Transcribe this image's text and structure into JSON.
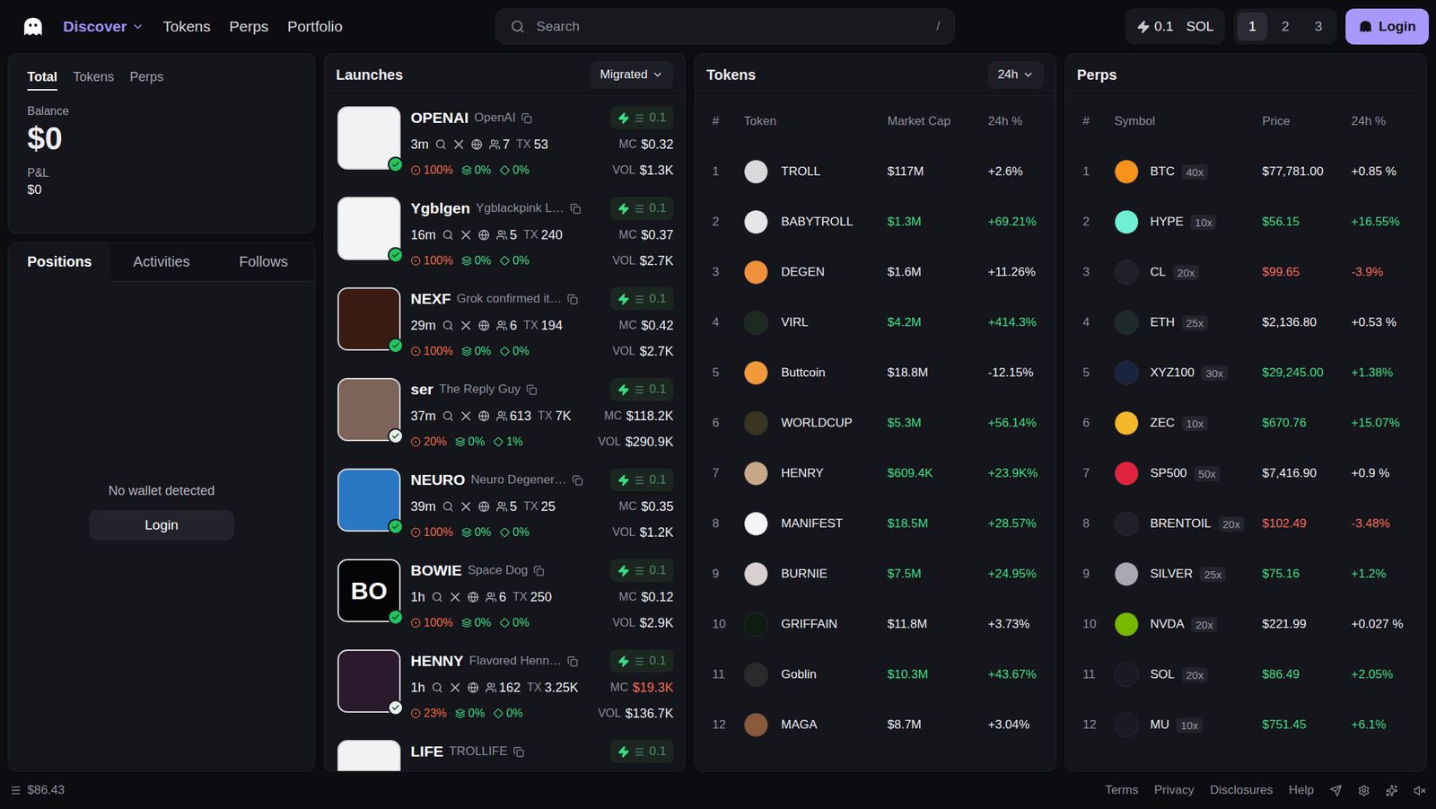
{
  "nav": {
    "items": [
      {
        "label": "Discover",
        "selected": true,
        "has_menu": true
      },
      {
        "label": "Tokens",
        "selected": false,
        "has_menu": false
      },
      {
        "label": "Perps",
        "selected": false,
        "has_menu": false
      },
      {
        "label": "Portfolio",
        "selected": false,
        "has_menu": false
      }
    ]
  },
  "search": {
    "placeholder": "Search",
    "shortcut": "/"
  },
  "quick_buy": {
    "amount": "0.1",
    "currency": "SOL"
  },
  "presets": [
    {
      "label": "1",
      "selected": true
    },
    {
      "label": "2",
      "selected": false
    },
    {
      "label": "3",
      "selected": false
    }
  ],
  "login_button": "Login",
  "account": {
    "tabs": [
      {
        "label": "Total",
        "selected": true
      },
      {
        "label": "Tokens",
        "selected": false
      },
      {
        "label": "Perps",
        "selected": false
      }
    ],
    "balance_label": "Balance",
    "balance": "$0",
    "pnl_label": "P&L",
    "pnl": "$0"
  },
  "positions": {
    "tabs": [
      {
        "label": "Positions",
        "selected": true
      },
      {
        "label": "Activities",
        "selected": false
      },
      {
        "label": "Follows",
        "selected": false
      }
    ],
    "empty_text": "No wallet detected",
    "login_button": "Login"
  },
  "launches": {
    "title": "Launches",
    "filter": "Migrated",
    "labels": {
      "tx": "TX",
      "mc": "MC",
      "vol": "VOL"
    },
    "rows": [
      {
        "name": "OPENAI",
        "desc": "OpenAI",
        "avatar": {
          "color": "#f2f2f4",
          "text": ""
        },
        "badge_color": "#22c55e",
        "buy": "0.1",
        "age": "3m",
        "holders": "7",
        "tx": "53",
        "mc": "$0.32",
        "mc_color": "#ececf1",
        "vol": "$1.3K",
        "stats": [
          "100%",
          "0%",
          "0%"
        ]
      },
      {
        "name": "Ygblgen",
        "desc": "Ygblackpink L…",
        "avatar": {
          "color": "#f4f4f4",
          "text": ""
        },
        "badge_color": "#22c55e",
        "buy": "0.1",
        "age": "16m",
        "holders": "5",
        "tx": "240",
        "mc": "$0.37",
        "mc_color": "#ececf1",
        "vol": "$2.7K",
        "stats": [
          "100%",
          "0%",
          "0%"
        ]
      },
      {
        "name": "NEXF",
        "desc": "Grok confirmed it…",
        "avatar": {
          "color": "#3a1c12",
          "text": ""
        },
        "badge_color": "#22c55e",
        "buy": "0.1",
        "age": "29m",
        "holders": "6",
        "tx": "194",
        "mc": "$0.42",
        "mc_color": "#ececf1",
        "vol": "$2.7K",
        "stats": [
          "100%",
          "0%",
          "0%"
        ]
      },
      {
        "name": "ser",
        "desc": "The Reply Guy",
        "avatar": {
          "color": "#7d6458",
          "text": ""
        },
        "badge_color": "#e8efe9",
        "buy": "0.1",
        "age": "37m",
        "holders": "613",
        "tx": "7K",
        "mc": "$118.2K",
        "mc_color": "#ececf1",
        "vol": "$290.9K",
        "stats": [
          "20%",
          "0%",
          "1%"
        ]
      },
      {
        "name": "NEURO",
        "desc": "Neuro Degener…",
        "avatar": {
          "color": "#2a78c4",
          "text": ""
        },
        "badge_color": "#22c55e",
        "buy": "0.1",
        "age": "39m",
        "holders": "5",
        "tx": "25",
        "mc": "$0.35",
        "mc_color": "#ececf1",
        "vol": "$1.2K",
        "stats": [
          "100%",
          "0%",
          "0%"
        ]
      },
      {
        "name": "BOWIE",
        "desc": "Space Dog",
        "avatar": {
          "color": "#050505",
          "text": "BO"
        },
        "badge_color": "#22c55e",
        "buy": "0.1",
        "age": "1h",
        "holders": "6",
        "tx": "250",
        "mc": "$0.12",
        "mc_color": "#ececf1",
        "vol": "$2.9K",
        "stats": [
          "100%",
          "0%",
          "0%"
        ]
      },
      {
        "name": "HENNY",
        "desc": "Flavored Henn…",
        "avatar": {
          "color": "#2b1a2e",
          "text": ""
        },
        "badge_color": "#e8efe9",
        "buy": "0.1",
        "age": "1h",
        "holders": "162",
        "tx": "3.25K",
        "mc": "$19.3K",
        "mc_color": "#f26b5b",
        "vol": "$136.7K",
        "stats": [
          "23%",
          "0%",
          "0%"
        ]
      },
      {
        "name": "LIFE",
        "desc": "TROLLIFE",
        "avatar": {
          "color": "#f2f2f2",
          "text": ""
        },
        "badge_color": "#22c55e",
        "buy": "0.1"
      }
    ]
  },
  "tokens": {
    "title": "Tokens",
    "period": "24h",
    "columns": [
      "#",
      "Token",
      "Market Cap",
      "24h %"
    ],
    "rows": [
      {
        "rank": "1",
        "name": "TROLL",
        "market_cap": "$117M",
        "change": "+2.6%",
        "updated": false,
        "color": "#d9d9d9"
      },
      {
        "rank": "2",
        "name": "BABYTROLL",
        "market_cap": "$1.3M",
        "change": "+69.21%",
        "updated": true,
        "color": "#e6e6e6"
      },
      {
        "rank": "3",
        "name": "DEGEN",
        "market_cap": "$1.6M",
        "change": "+11.26%",
        "updated": false,
        "color": "#f0913a"
      },
      {
        "rank": "4",
        "name": "VIRL",
        "market_cap": "$4.2M",
        "change": "+414.3%",
        "updated": true,
        "color": "#1d2a21"
      },
      {
        "rank": "5",
        "name": "Buttcoin",
        "market_cap": "$18.8M",
        "change": "-12.15%",
        "updated": false,
        "color": "#f29a3b"
      },
      {
        "rank": "6",
        "name": "WORLDCUP",
        "market_cap": "$5.3M",
        "change": "+56.14%",
        "updated": true,
        "color": "#3a3520"
      },
      {
        "rank": "7",
        "name": "HENRY",
        "market_cap": "$609.4K",
        "change": "+23.9K%",
        "updated": true,
        "color": "#c9a88a"
      },
      {
        "rank": "8",
        "name": "MANIFEST",
        "market_cap": "$18.5M",
        "change": "+28.57%",
        "updated": true,
        "color": "#f5f5f5"
      },
      {
        "rank": "9",
        "name": "BURNIE",
        "market_cap": "$7.5M",
        "change": "+24.95%",
        "updated": true,
        "color": "#d8d0d0"
      },
      {
        "rank": "10",
        "name": "GRIFFAIN",
        "market_cap": "$11.8M",
        "change": "+3.73%",
        "updated": false,
        "color": "#0f1c12"
      },
      {
        "rank": "11",
        "name": "Goblin",
        "market_cap": "$10.3M",
        "change": "+43.67%",
        "updated": true,
        "color": "#2a2a2a"
      },
      {
        "rank": "12",
        "name": "MAGA",
        "market_cap": "$8.7M",
        "change": "+3.04%",
        "updated": false,
        "color": "#8a5a3a"
      }
    ]
  },
  "perps": {
    "title": "Perps",
    "columns": [
      "#",
      "Symbol",
      "Price",
      "24h %"
    ],
    "rows": [
      {
        "rank": "1",
        "symbol": "BTC",
        "leverage": "40x",
        "price": "$77,781.00",
        "change": "+0.85 %",
        "trend": "flat",
        "color": "#f7931a"
      },
      {
        "rank": "2",
        "symbol": "HYPE",
        "leverage": "10x",
        "price": "$56.15",
        "change": "+16.55%",
        "trend": "up",
        "color": "#6ff0d3"
      },
      {
        "rank": "3",
        "symbol": "CL",
        "leverage": "20x",
        "price": "$99.65",
        "change": "-3.9%",
        "trend": "down",
        "color": "#202028"
      },
      {
        "rank": "4",
        "symbol": "ETH",
        "leverage": "25x",
        "price": "$2,136.80",
        "change": "+0.53 %",
        "trend": "flat",
        "color": "#1f2a2a"
      },
      {
        "rank": "5",
        "symbol": "XYZ100",
        "leverage": "30x",
        "price": "$29,245.00",
        "change": "+1.38%",
        "trend": "up",
        "color": "#1a2340"
      },
      {
        "rank": "6",
        "symbol": "ZEC",
        "leverage": "10x",
        "price": "$670.76",
        "change": "+15.07%",
        "trend": "up",
        "color": "#f4b728"
      },
      {
        "rank": "7",
        "symbol": "SP500",
        "leverage": "50x",
        "price": "$7,416.90",
        "change": "+0.9 %",
        "trend": "flat",
        "color": "#e0233d"
      },
      {
        "rank": "8",
        "symbol": "BRENTOIL",
        "leverage": "20x",
        "price": "$102.49",
        "change": "-3.48%",
        "trend": "down",
        "color": "#202028"
      },
      {
        "rank": "9",
        "symbol": "SILVER",
        "leverage": "25x",
        "price": "$75.16",
        "change": "+1.2%",
        "trend": "up",
        "color": "#a9a9b3"
      },
      {
        "rank": "10",
        "symbol": "NVDA",
        "leverage": "20x",
        "price": "$221.99",
        "change": "+0.027 %",
        "trend": "flat",
        "color": "#76b900"
      },
      {
        "rank": "11",
        "symbol": "SOL",
        "leverage": "20x",
        "price": "$86.49",
        "change": "+2.05%",
        "trend": "up",
        "color": "#1a1a24"
      },
      {
        "rank": "12",
        "symbol": "MU",
        "leverage": "10x",
        "price": "$751.45",
        "change": "+6.1%",
        "trend": "up",
        "color": "#1a1a24"
      }
    ]
  },
  "status_bar": {
    "sol_price": "$86.43",
    "links": [
      "Terms",
      "Privacy",
      "Disclosures",
      "Help"
    ]
  }
}
